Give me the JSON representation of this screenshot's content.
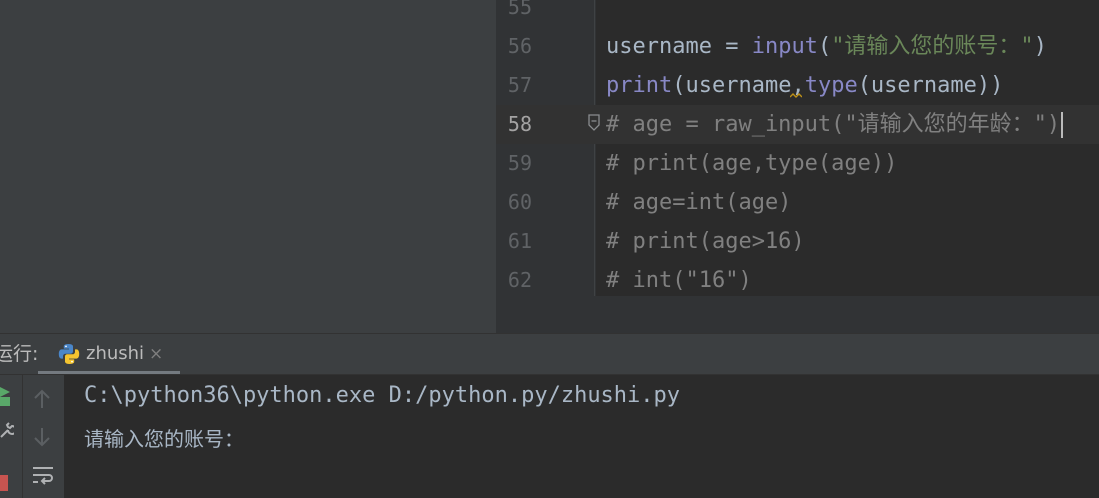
{
  "editor": {
    "lines": [
      {
        "number": "55",
        "tokens": []
      },
      {
        "number": "56",
        "tokens": [
          {
            "text": "username = ",
            "cls": ""
          },
          {
            "text": "input",
            "cls": "t-builtin"
          },
          {
            "text": "(",
            "cls": ""
          },
          {
            "text": "\"请输入您的账号：\"",
            "cls": "t-str"
          },
          {
            "text": ")",
            "cls": ""
          }
        ]
      },
      {
        "number": "57",
        "tokens": [
          {
            "text": "print",
            "cls": "t-builtin"
          },
          {
            "text": "(username",
            "cls": ""
          },
          {
            "text": ",",
            "cls": "t-sq"
          },
          {
            "text": "type",
            "cls": "t-builtin"
          },
          {
            "text": "(username))",
            "cls": ""
          }
        ]
      },
      {
        "number": "58",
        "current": true,
        "tokens": [
          {
            "text": "# age = raw_input(\"请输入您的年龄：\")",
            "cls": "t-comment"
          }
        ]
      },
      {
        "number": "59",
        "tokens": [
          {
            "text": "# print(age,type(age))",
            "cls": "t-comment"
          }
        ]
      },
      {
        "number": "60",
        "tokens": [
          {
            "text": "# age=int(age)",
            "cls": "t-comment"
          }
        ]
      },
      {
        "number": "61",
        "tokens": [
          {
            "text": "# print(age>16)",
            "cls": "t-comment"
          }
        ]
      },
      {
        "number": "62",
        "tokens": [
          {
            "text": "# int(\"16\")",
            "cls": "t-comment"
          }
        ]
      }
    ]
  },
  "run_panel": {
    "label": "运行:",
    "tab": {
      "name": "zhushi",
      "close": "×",
      "icon": "python-icon"
    },
    "console": {
      "command_line": "C:\\python36\\python.exe D:/python.py/zhushi.py",
      "prompt_line": "请输入您的账号："
    },
    "tools": [
      "rerun-icon",
      "settings-icon",
      "stop-icon",
      "scroll-up-icon",
      "scroll-down-icon",
      "soft-wrap-icon"
    ]
  },
  "colors": {
    "editor_bg": "#2b2b2b",
    "panel_bg": "#3c3f41",
    "builtin": "#8888c6",
    "string": "#6a8759",
    "comment": "#808080",
    "text": "#a9b7c6"
  }
}
